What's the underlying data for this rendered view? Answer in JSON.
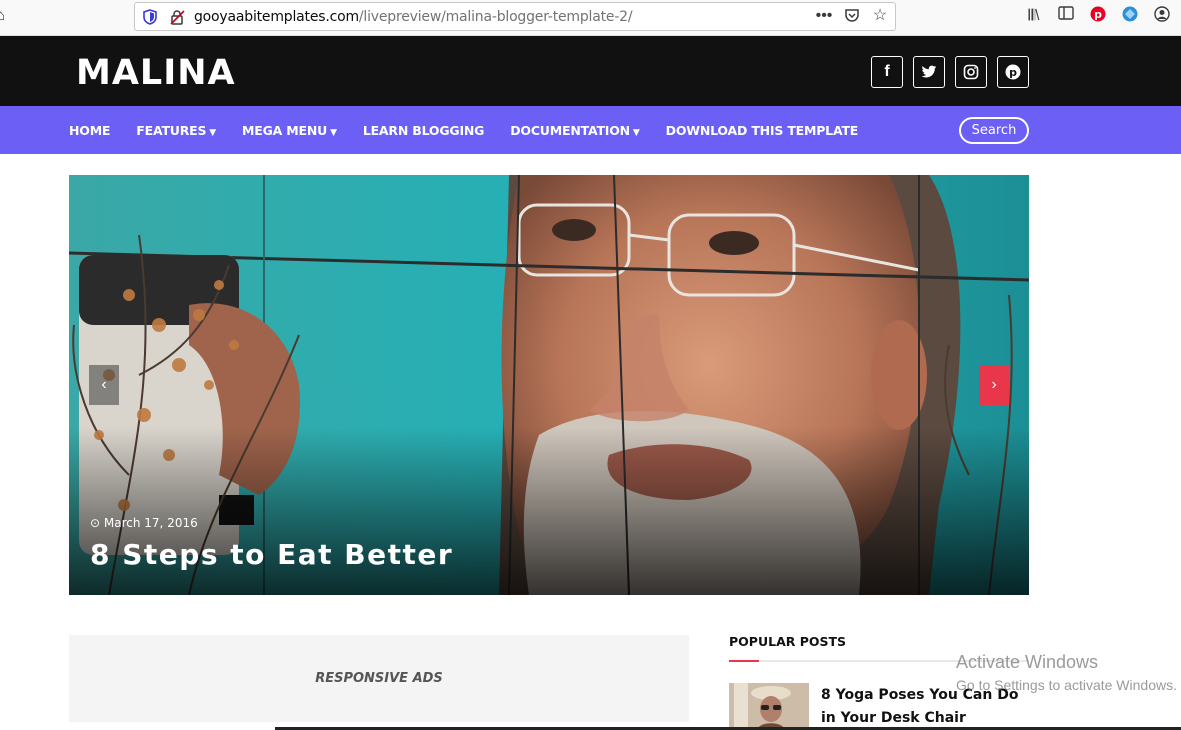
{
  "browser": {
    "url_domain": "gooyaabitemplates.com",
    "url_path": "/livepreview/malina-blogger-template-2/",
    "icons": [
      "home-icon",
      "shield-icon",
      "insecure-icon",
      "more-icon",
      "pocket-icon",
      "bookmark-star-icon",
      "library-icon",
      "sidebar-icon",
      "pinterest-icon",
      "extension-icon",
      "account-icon"
    ]
  },
  "header": {
    "logo": "MALINA",
    "socials": [
      {
        "name": "facebook",
        "glyph": "f"
      },
      {
        "name": "twitter",
        "glyph": "t"
      },
      {
        "name": "instagram",
        "glyph": "◎"
      },
      {
        "name": "pinterest",
        "glyph": "P"
      }
    ]
  },
  "nav": {
    "items": [
      {
        "label": "HOME",
        "dropdown": false
      },
      {
        "label": "FEATURES",
        "dropdown": true
      },
      {
        "label": "MEGA MENU",
        "dropdown": true
      },
      {
        "label": "LEARN BLOGGING",
        "dropdown": false
      },
      {
        "label": "DOCUMENTATION",
        "dropdown": true
      },
      {
        "label": "DOWNLOAD THIS TEMPLATE",
        "dropdown": false
      }
    ],
    "search_label": "Search"
  },
  "slider": {
    "date": "March 17, 2016",
    "title": "8 Steps to Eat Better",
    "prev_glyph": "‹",
    "next_glyph": "›"
  },
  "ads": {
    "label": "RESPONSIVE ADS"
  },
  "popular": {
    "title": "POPULAR POSTS",
    "posts": [
      {
        "title": "8 Yoga Poses You Can Do in Your Desk Chair"
      }
    ]
  },
  "watermark": {
    "line1": "Activate Windows",
    "line2": "Go to Settings to activate Windows."
  },
  "colors": {
    "nav_bg": "#6c5ff5",
    "header_bg": "#111111",
    "accent": "#e8374b"
  }
}
